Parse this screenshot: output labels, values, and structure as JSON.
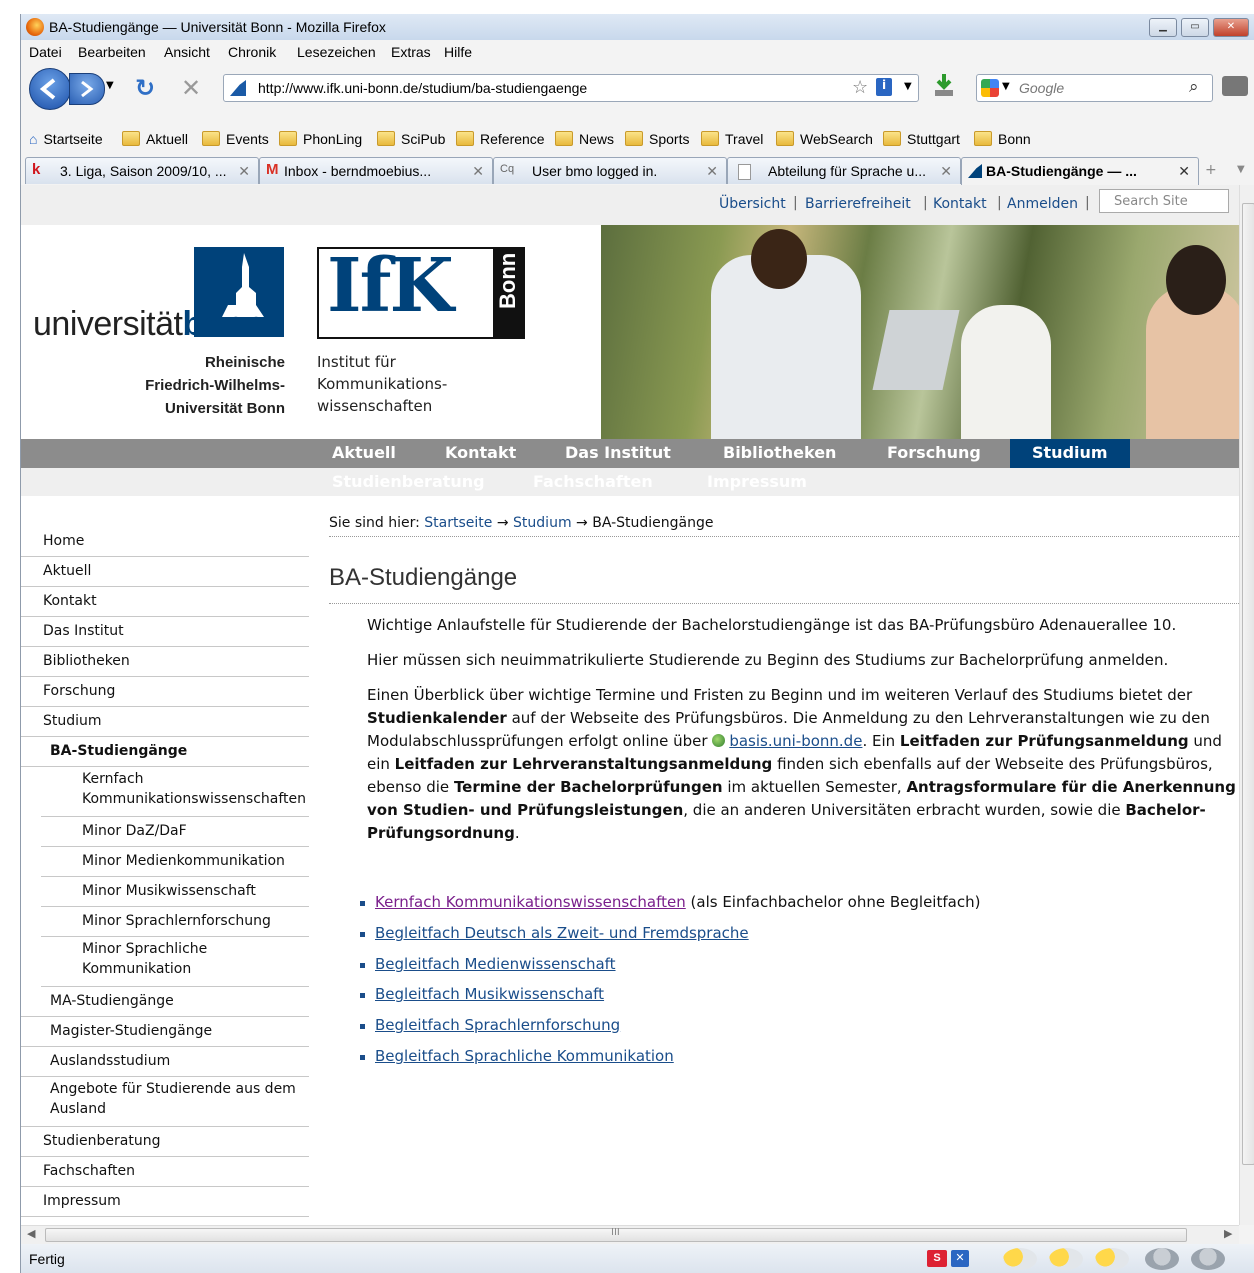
{
  "window": {
    "title": "BA-Studiengänge — Universität Bonn - Mozilla Firefox"
  },
  "menu": [
    "Datei",
    "Bearbeiten",
    "Ansicht",
    "Chronik",
    "Lesezeichen",
    "Extras",
    "Hilfe"
  ],
  "url": "http://www.ifk.uni-bonn.de/studium/ba-studiengaenge",
  "search": {
    "placeholder": "Google"
  },
  "bookmarks": [
    "Startseite",
    "Aktuell",
    "Events",
    "PhonLing",
    "SciPub",
    "Reference",
    "News",
    "Sports",
    "Travel",
    "WebSearch",
    "Stuttgart",
    "Bonn"
  ],
  "tabs": [
    {
      "label": "3. Liga, Saison 2009/10, ..."
    },
    {
      "label": "Inbox - berndmoebius..."
    },
    {
      "label": "User bmo logged in."
    },
    {
      "label": "Abteilung für Sprache u..."
    },
    {
      "label": "BA-Studiengänge — ..."
    }
  ],
  "util_links": [
    "Übersicht",
    "Barrierefreiheit",
    "Kontakt",
    "Anmelden"
  ],
  "site_search": {
    "placeholder": "Search Site"
  },
  "logo": {
    "uni_light": "universität",
    "uni_bold": "bonn",
    "uni_sub": [
      "Rheinische",
      "Friedrich-Wilhelms-",
      "Universität Bonn"
    ],
    "ifk": "IfK",
    "ifk_side": "Bonn",
    "ifk_sub": [
      "Institut für",
      "Kommunikations-",
      "wissenschaften"
    ]
  },
  "main_nav": [
    "Aktuell",
    "Kontakt",
    "Das Institut",
    "Bibliotheken",
    "Forschung",
    "Studium"
  ],
  "sub_nav": [
    "Studienberatung",
    "Fachschaften",
    "Impressum"
  ],
  "sidebar": [
    "Home",
    "Aktuell",
    "Kontakt",
    "Das Institut",
    "Bibliotheken",
    "Forschung",
    "Studium",
    "BA-Studiengänge",
    "Kernfach Kommunikationswissenschaften",
    "Minor DaZ/DaF",
    "Minor Medienkommunikation",
    "Minor Musikwissenschaft",
    "Minor Sprachlernforschung",
    "Minor Sprachliche Kommunikation",
    "MA-Studiengänge",
    "Magister-Studiengänge",
    "Auslandsstudium",
    "Angebote für Studierende aus dem Ausland",
    "Studienberatung",
    "Fachschaften",
    "Impressum"
  ],
  "breadcrumb": {
    "prefix": "Sie sind hier:",
    "home": "Startseite",
    "section": "Studium",
    "current": "BA-Studiengänge",
    "arrow": "→"
  },
  "page_title": "BA-Studiengänge",
  "paragraphs": {
    "p1": "Wichtige Anlaufstelle für Studierende der Bachelorstudiengänge ist das BA-Prüfungsbüro Adenauerallee 10.",
    "p2": "Hier müssen sich neuimmatrikulierte Studierende zu Beginn des Studiums zur Bachelorprüfung anmelden.",
    "p3": {
      "t1": "Einen Überblick über wichtige Termine und Fristen zu Beginn und im weiteren Verlauf des Studiums bietet der ",
      "b1": "Studienkalender",
      "t2": " auf der Webseite des Prüfungsbüros. Die Anmeldung zu den Lehrveranstaltungen wie zu den Modulabschlussprüfungen erfolgt online über ",
      "link": "basis.uni-bonn.de",
      "t3": ". Ein ",
      "b2": "Leitfaden zur Prüfungsanmeldung",
      "t4": " und ein ",
      "b3": "Leitfaden zur Lehrveranstaltungsanmeldung",
      "t5": " finden sich ebenfalls auf der Webseite des Prüfungsbüros, ebenso die ",
      "b4": "Termine der Bachelorprüfungen",
      "t6": " im aktuellen Semester, ",
      "b5": "Antragsformulare für die Anerkennung von Studien- und Prüfungsleistungen",
      "t7": ", die an anderen Universitäten erbracht wurden, sowie die ",
      "b6": "Bachelor-Prüfungsordnung",
      "t8": "."
    }
  },
  "links": [
    {
      "label": "Kernfach Kommunikationswissenschaften",
      "suffix": " (als Einfachbachelor ohne Begleitfach)"
    },
    {
      "label": "Begleitfach Deutsch als Zweit- und Fremdsprache",
      "suffix": ""
    },
    {
      "label": "Begleitfach Medienwissenschaft",
      "suffix": ""
    },
    {
      "label": "Begleitfach Musikwissenschaft",
      "suffix": ""
    },
    {
      "label": "Begleitfach Sprachlernforschung",
      "suffix": ""
    },
    {
      "label": "Begleitfach Sprachliche Kommunikation",
      "suffix": ""
    }
  ],
  "status": {
    "text": "Fertig",
    "scroll_grip": "III"
  },
  "colors": {
    "brand": "#00427a",
    "link": "#1a4d8a",
    "visited": "#7a1f8c",
    "nav_bg": "#8c8c8c"
  }
}
